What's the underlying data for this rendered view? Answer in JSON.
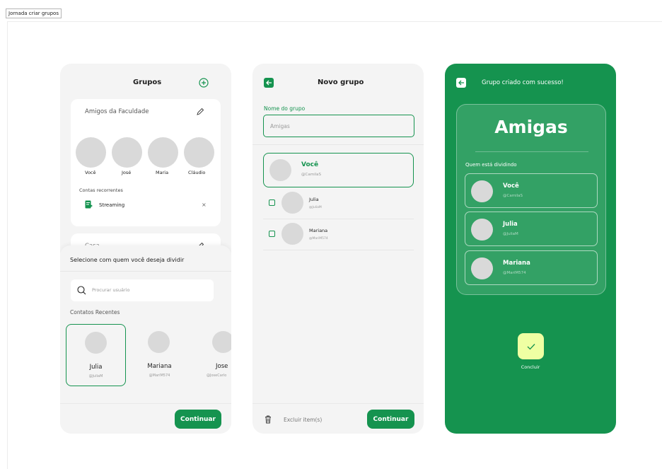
{
  "frame_label": "Jornada criar grupos",
  "screen1": {
    "title": "Grupos",
    "group1": {
      "name": "Amigos da Faculdade",
      "members": [
        "Você",
        "José",
        "Maria",
        "Cláudio"
      ],
      "recurring_label": "Contas recorrentes",
      "bill": "Streaming",
      "remove_symbol": "×"
    },
    "group2_name": "Casa",
    "sheet": {
      "title": "Selecione com quem você deseja dividir",
      "search_placeholder": "Procurar usuário",
      "recent_label": "Contatos Recentes",
      "contacts": [
        {
          "name": "Julia",
          "handle": "@JuliaM"
        },
        {
          "name": "Mariana",
          "handle": "@MariM574"
        },
        {
          "name": "Jose",
          "handle": "@JoseCarlo"
        }
      ]
    },
    "continue_label": "Continuar"
  },
  "screen2": {
    "title": "Novo grupo",
    "name_label": "Nome do grupo",
    "name_value": "Amigas",
    "members": [
      {
        "name": "Você",
        "handle": "@CamilaS"
      },
      {
        "name": "Julia",
        "handle": "@JuliaM"
      },
      {
        "name": "Mariana",
        "handle": "@MariM574"
      }
    ],
    "delete_label": "Excluir item(s)",
    "continue_label": "Continuar"
  },
  "screen3": {
    "title": "Grupo criado com sucesso!",
    "group_name": "Amigas",
    "sharing_label": "Quem está dividindo",
    "members": [
      {
        "name": "Você",
        "handle": "@CamilaS"
      },
      {
        "name": "Julia",
        "handle": "@JuliaM"
      },
      {
        "name": "Mariana",
        "handle": "@MariM574"
      }
    ],
    "conclude_label": "Concluir"
  },
  "colors": {
    "primary": "#15934f",
    "accent": "#efffa3",
    "avatar": "#d9d9d9",
    "screen_bg": "#f4f4f4"
  }
}
